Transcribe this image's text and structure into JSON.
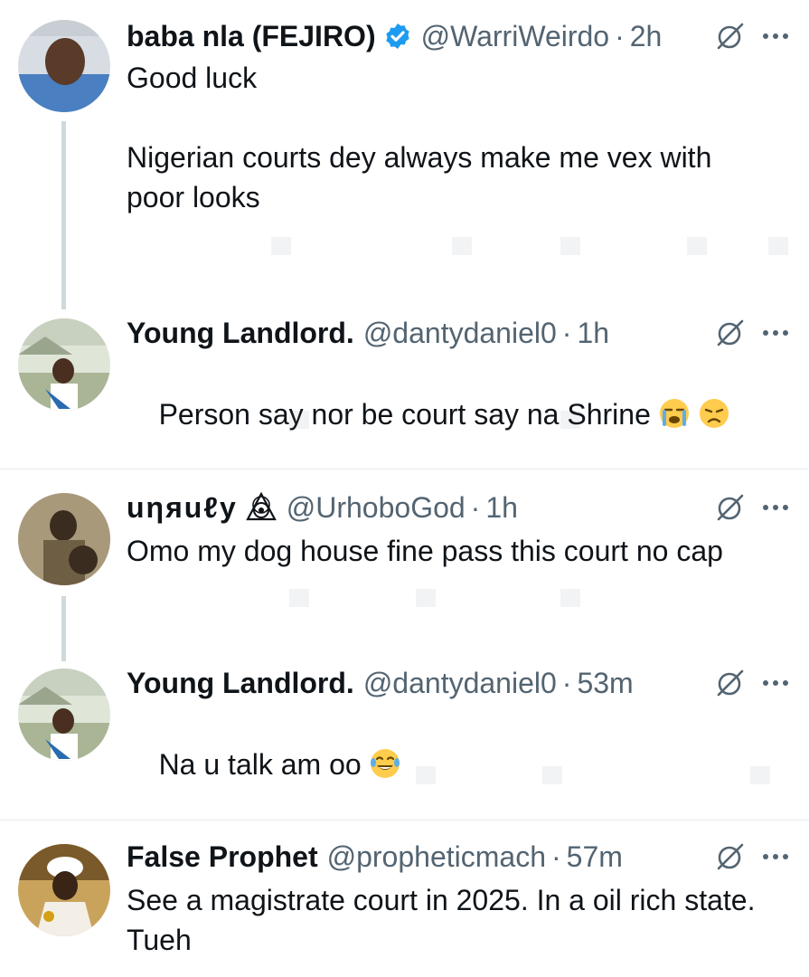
{
  "tweets": [
    {
      "name": "baba nla (FEJIRO)",
      "verified": true,
      "handle": "@WarriWeirdo",
      "separator": "·",
      "time": "2h",
      "text": "Good luck\n\nNigerian courts dey always make me vex with poor looks",
      "emojis": []
    },
    {
      "name": "Young Landlord.",
      "handle": "@dantydaniel0",
      "separator": "·",
      "time": "1h",
      "text": "Person say nor be court say na Shrine",
      "emojis": [
        "loudly-crying-face",
        "disappointed-face"
      ]
    },
    {
      "name": "uηяuℓy",
      "handle": "@UrhoboGod",
      "separator": "·",
      "time": "1h",
      "text": "Omo my dog house fine pass this court no cap",
      "emojis": []
    },
    {
      "name": "Young Landlord.",
      "handle": "@dantydaniel0",
      "separator": "·",
      "time": "53m",
      "text": "Na u talk am oo",
      "emojis": [
        "tears-of-joy-face"
      ]
    },
    {
      "name": "False Prophet",
      "handle": "@propheticmach",
      "separator": "·",
      "time": "57m",
      "text": "See a magistrate court in 2025. In a oil rich state. Tueh",
      "emojis": []
    }
  ],
  "colors": {
    "text": "#0f1419",
    "secondary": "#536471",
    "verified": "#1d9bf0",
    "thread_line": "#cfd9de",
    "divider": "#e6ecf0"
  }
}
